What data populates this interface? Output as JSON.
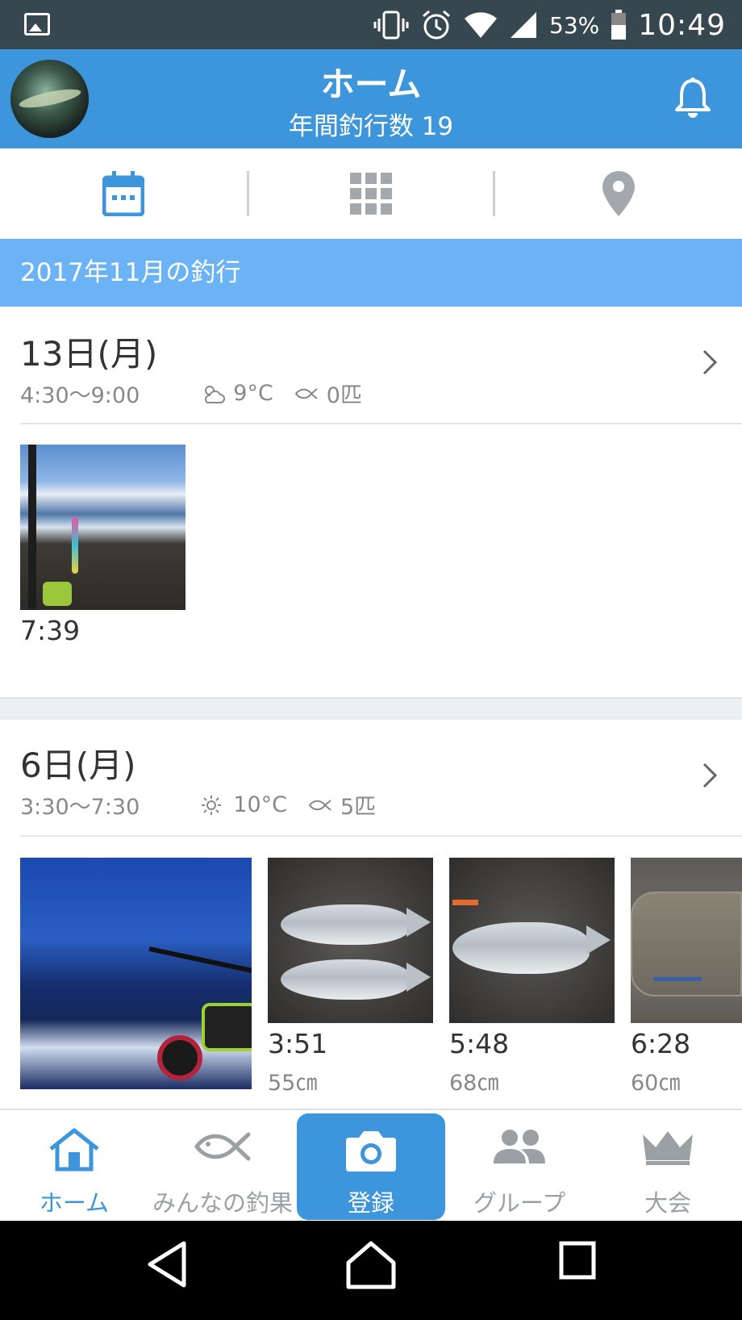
{
  "status_bar": {
    "battery_percent": "53%",
    "time": "10:49"
  },
  "header": {
    "title": "ホーム",
    "subtitle": "年間釣行数 19"
  },
  "view_tabs": [
    "calendar-icon",
    "grid-icon",
    "map-pin-icon"
  ],
  "month_banner": "2017年11月の釣行",
  "trips": [
    {
      "date": "13日(月)",
      "time_range": "4:30〜9:00",
      "weather_icon": "cloud-sun-icon",
      "temperature": "9°C",
      "catch_count": "0匹",
      "photos": [
        {
          "time": "7:39",
          "size": ""
        }
      ]
    },
    {
      "date": "6日(月)",
      "time_range": "3:30〜7:30",
      "weather_icon": "sun-icon",
      "temperature": "10°C",
      "catch_count": "5匹",
      "photos": [
        {
          "time": "",
          "size": ""
        },
        {
          "time": "3:51",
          "size": "55㎝"
        },
        {
          "time": "5:48",
          "size": "68㎝"
        },
        {
          "time": "6:28",
          "size": "60㎝"
        }
      ]
    }
  ],
  "bottom_nav": [
    {
      "label": "ホーム",
      "icon": "home-icon",
      "active": true
    },
    {
      "label": "みんなの釣果",
      "icon": "fish-icon",
      "active": false
    },
    {
      "label": "登録",
      "icon": "camera-icon",
      "active": false
    },
    {
      "label": "グループ",
      "icon": "group-icon",
      "active": false
    },
    {
      "label": "大会",
      "icon": "crown-icon",
      "active": false
    }
  ],
  "colors": {
    "header": "#3d95db",
    "month_banner": "#6cb3f5",
    "status_bar": "#37474f",
    "inactive": "#9aa0a4"
  }
}
